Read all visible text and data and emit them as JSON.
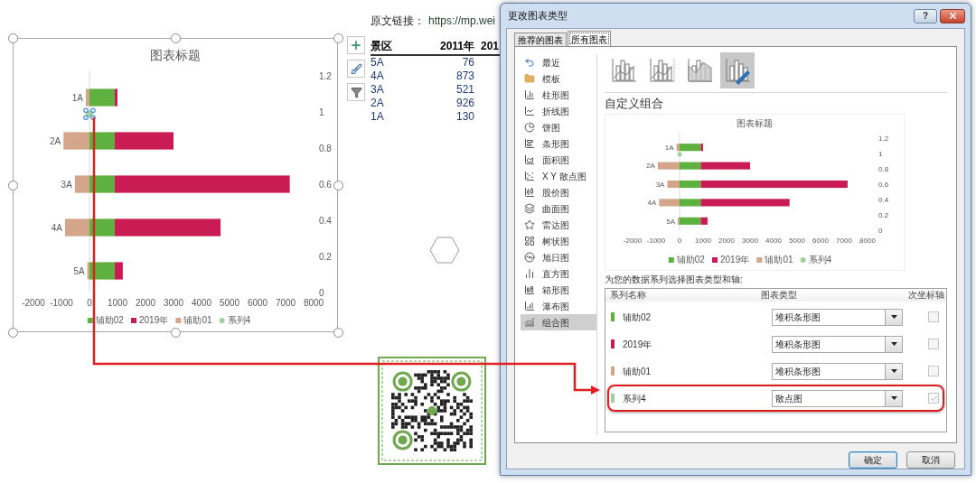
{
  "left_chart": {
    "selected": true,
    "selected_point": true,
    "series_marks": [
      {
        "kind": "bar"
      },
      {
        "kind": "bar"
      },
      {
        "kind": "bar"
      },
      {
        "kind": "point"
      }
    ],
    "secondary_axis_labels": [
      "1.2",
      "1",
      "0.8",
      "0.6",
      "0.4",
      "0.2",
      "0"
    ],
    "chart_data": {
      "type": "bar",
      "orientation": "horizontal",
      "stacked": true,
      "title": "图表标题",
      "categories": [
        "1A",
        "2A",
        "3A",
        "4A",
        "5A"
      ],
      "series": [
        {
          "name": "辅助02",
          "color": "#5fb13f",
          "values": [
            900,
            900,
            900,
            900,
            900
          ]
        },
        {
          "name": "2019年",
          "color": "#c91c55",
          "values": [
            100,
            2100,
            6250,
            3780,
            290
          ]
        },
        {
          "name": "辅助01",
          "color": "#d4a58b",
          "values": [
            -130,
            -926,
            -521,
            -873,
            -76
          ]
        },
        {
          "name": "系列4",
          "color": "#9fd19f",
          "values": [
            0,
            null,
            null,
            null,
            null
          ]
        }
      ],
      "xlim": [
        -2000,
        8000
      ],
      "xticks": [
        -2000,
        -1000,
        0,
        1000,
        2000,
        3000,
        4000,
        5000,
        6000,
        7000,
        8000
      ],
      "legend": "bottom"
    }
  },
  "source_link": {
    "label": "原文链接：",
    "url": "https://mp.wei"
  },
  "table": {
    "columns": [
      "景区",
      "2011年",
      "201"
    ],
    "rows": [
      [
        "5A",
        "76"
      ],
      [
        "4A",
        "873"
      ],
      [
        "3A",
        "521"
      ],
      [
        "2A",
        "926"
      ],
      [
        "1A",
        "130"
      ]
    ]
  },
  "dialog": {
    "title": "更改图表类型",
    "help": "?",
    "tabs": [
      {
        "label": "推荐的图表",
        "selected": false
      },
      {
        "label": "所有图表",
        "selected": true
      }
    ],
    "categories": [
      {
        "label": "最近",
        "selected": false
      },
      {
        "label": "模板",
        "selected": false
      },
      {
        "label": "柱形图",
        "selected": false
      },
      {
        "label": "折线图",
        "selected": false
      },
      {
        "label": "饼图",
        "selected": false
      },
      {
        "label": "条形图",
        "selected": false
      },
      {
        "label": "面积图",
        "selected": false
      },
      {
        "label": "X Y 散点图",
        "selected": false
      },
      {
        "label": "股价图",
        "selected": false
      },
      {
        "label": "曲面图",
        "selected": false
      },
      {
        "label": "雷达图",
        "selected": false
      },
      {
        "label": "树状图",
        "selected": false
      },
      {
        "label": "旭日图",
        "selected": false
      },
      {
        "label": "直方图",
        "selected": false
      },
      {
        "label": "箱形图",
        "selected": false
      },
      {
        "label": "瀑布图",
        "selected": false
      },
      {
        "label": "组合图",
        "selected": true
      }
    ],
    "combo_variants": [
      {
        "selected": false
      },
      {
        "selected": false
      },
      {
        "selected": false
      },
      {
        "selected": true
      }
    ],
    "heading": "自定义组合",
    "preview": {
      "series_marks": [
        {
          "kind": "bar"
        },
        {
          "kind": "bar"
        },
        {
          "kind": "bar"
        },
        {
          "kind": "point"
        }
      ],
      "secondary_axis_labels": [
        "1.2",
        "1",
        "0.8",
        "0.6",
        "0.4",
        "0.2",
        "0"
      ],
      "chart_data": {
        "type": "bar",
        "orientation": "horizontal",
        "stacked": true,
        "title": "图表标题",
        "categories": [
          "1A",
          "2A",
          "3A",
          "4A",
          "5A"
        ],
        "series": [
          {
            "name": "辅助02",
            "color": "#5fb13f",
            "values": [
              900,
              900,
              900,
              900,
              900
            ]
          },
          {
            "name": "2019年",
            "color": "#c91c55",
            "values": [
              100,
              2100,
              6250,
              3780,
              290
            ]
          },
          {
            "name": "辅助01",
            "color": "#d4a58b",
            "values": [
              -130,
              -926,
              -521,
              -873,
              -76
            ]
          },
          {
            "name": "系列4",
            "color": "#9fd19f",
            "values": [
              0,
              null,
              null,
              null,
              null
            ]
          }
        ],
        "xlim": [
          -2000,
          8000
        ],
        "xticks": [
          -2000,
          -1000,
          0,
          1000,
          2000,
          3000,
          4000,
          5000,
          6000,
          7000,
          8000
        ],
        "legend": "bottom"
      }
    },
    "series_prompt": "为您的数据系列选择图表类型和轴:",
    "series_table": {
      "columns": [
        "系列名称",
        "图表类型",
        "次坐标轴"
      ],
      "rows": [
        {
          "name": "辅助02",
          "color": "#5fb13f",
          "chart_type": "堆积条形图",
          "secondary_axis": false,
          "highlighted": false
        },
        {
          "name": "2019年",
          "color": "#c91c55",
          "chart_type": "堆积条形图",
          "secondary_axis": false,
          "highlighted": false
        },
        {
          "name": "辅助01",
          "color": "#d4a58b",
          "chart_type": "堆积条形图",
          "secondary_axis": false,
          "highlighted": false
        },
        {
          "name": "系列4",
          "color": "#9fd19f",
          "chart_type": "散点图",
          "secondary_axis": true,
          "highlighted": true
        }
      ]
    },
    "buttons": [
      {
        "label": "确定",
        "default": true
      },
      {
        "label": "取消",
        "default": false
      }
    ]
  }
}
